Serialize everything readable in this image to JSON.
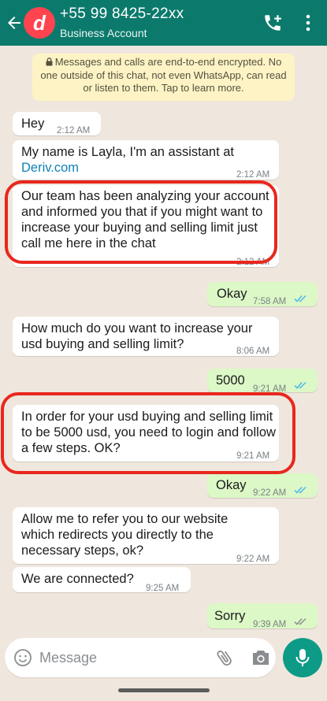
{
  "header": {
    "avatar_letter": "d",
    "contact_name": "+55 99 8425-22xx",
    "contact_sub": "Business Account",
    "back_icon": "arrow-left-icon",
    "call_icon": "add-call-icon",
    "menu_icon": "more-vertical-icon"
  },
  "encryption_notice": "Messages and calls are end-to-end encrypted. No one outside of this chat, not even WhatsApp, can read or listen to them. Tap to learn more.",
  "messages": [
    {
      "direction": "in",
      "text": "Hey",
      "time": "2:12 AM"
    },
    {
      "direction": "in",
      "text": "My name is Layla, I'm an assistant at",
      "link": "Deriv.com",
      "time": "2:12 AM"
    },
    {
      "direction": "in",
      "text": "Our team has been analyzing your account and informed you that if you might want to increase your buying and selling limit just call me here in the chat",
      "time": "2:12 AM",
      "highlighted": true
    },
    {
      "direction": "out",
      "text": "Okay",
      "time": "7:58 AM",
      "status": "read"
    },
    {
      "direction": "in",
      "text": "How much do you want to increase your usd buying and selling limit?",
      "time": "8:06 AM"
    },
    {
      "direction": "out",
      "text": "5000",
      "time": "9:21 AM",
      "status": "read"
    },
    {
      "direction": "in",
      "text": "In order for your usd buying and selling limit to be 5000 usd, you need to login and follow a few steps. OK?",
      "time": "9:21 AM",
      "highlighted": true
    },
    {
      "direction": "out",
      "text": "Okay",
      "time": "9:22 AM",
      "status": "read"
    },
    {
      "direction": "in",
      "text": "Allow me to refer you to our website which redirects you directly to the necessary steps, ok?",
      "time": "9:22 AM"
    },
    {
      "direction": "in",
      "text": "We are connected?",
      "time": "9:25 AM"
    },
    {
      "direction": "out",
      "text": "Sorry",
      "time": "9:39 AM",
      "status": "delivered"
    }
  ],
  "input": {
    "placeholder": "Message"
  },
  "colors": {
    "header": "#0b7a6c",
    "outgoing": "#dcf8c6",
    "incoming": "#ffffff",
    "highlight": "#e8271d",
    "read_ticks": "#4fb6ec",
    "mic": "#0d9b87"
  }
}
